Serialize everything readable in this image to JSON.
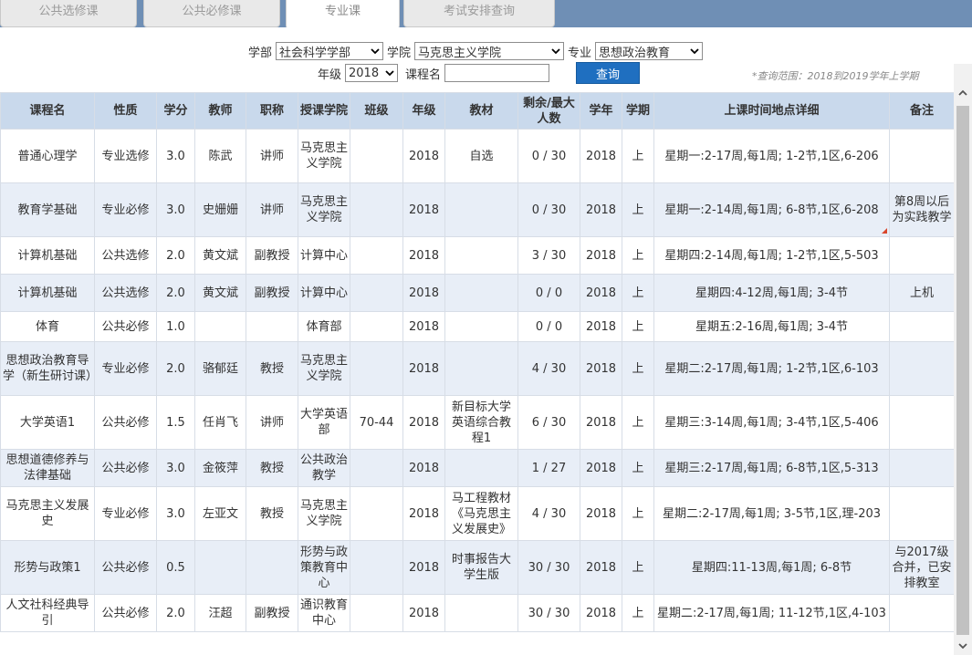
{
  "tabs": [
    {
      "label": "公共选修课",
      "active": false
    },
    {
      "label": "公共必修课",
      "active": false
    },
    {
      "label": "专业课",
      "active": true
    },
    {
      "label": "考试安排查询",
      "active": false
    }
  ],
  "filters": {
    "department_label": "学部",
    "department_value": "社会科学学部",
    "college_label": "学院",
    "college_value": "马克思主义学院",
    "major_label": "专业",
    "major_value": "思想政治教育",
    "grade_label": "年级",
    "grade_value": "2018",
    "course_name_label": "课程名",
    "course_name_value": "",
    "query_button": "查询",
    "query_range_note": "*查询范围：2018到2019学年上学期"
  },
  "table": {
    "headers": [
      "课程名",
      "性质",
      "学分",
      "教师",
      "职称",
      "授课学院",
      "班级",
      "年级",
      "教材",
      "剩余/最大人数",
      "学年",
      "学期",
      "上课时间地点详细",
      "备注"
    ],
    "rows": [
      {
        "course": "普通心理学",
        "type": "专业选修",
        "credit": "3.0",
        "teacher": "陈武",
        "title": "讲师",
        "college": "马克思主义学院",
        "class": "",
        "grade": "2018",
        "textbook": "自选",
        "capacity": "0 / 30",
        "year": "2018",
        "term": "上",
        "schedule": "星期一:2-17周,每1周; 1-2节,1区,6-206",
        "note": ""
      },
      {
        "course": "教育学基础",
        "type": "专业必修",
        "credit": "3.0",
        "teacher": "史姗姗",
        "title": "讲师",
        "college": "马克思主义学院",
        "class": "",
        "grade": "2018",
        "textbook": "",
        "capacity": "0 / 30",
        "year": "2018",
        "term": "上",
        "schedule": "星期一:2-14周,每1周; 6-8节,1区,6-208",
        "note": "第8周以后为实践教学"
      },
      {
        "course": "计算机基础",
        "type": "公共选修",
        "credit": "2.0",
        "teacher": "黄文斌",
        "title": "副教授",
        "college": "计算中心",
        "class": "",
        "grade": "2018",
        "textbook": "",
        "capacity": "3 / 30",
        "year": "2018",
        "term": "上",
        "schedule": "星期四:2-14周,每1周; 1-2节,1区,5-503",
        "note": ""
      },
      {
        "course": "计算机基础",
        "type": "公共选修",
        "credit": "2.0",
        "teacher": "黄文斌",
        "title": "副教授",
        "college": "计算中心",
        "class": "",
        "grade": "2018",
        "textbook": "",
        "capacity": "0 / 0",
        "year": "2018",
        "term": "上",
        "schedule": "星期四:4-12周,每1周; 3-4节",
        "note": "上机"
      },
      {
        "course": "体育",
        "type": "公共必修",
        "credit": "1.0",
        "teacher": "",
        "title": "",
        "college": "体育部",
        "class": "",
        "grade": "2018",
        "textbook": "",
        "capacity": "0 / 0",
        "year": "2018",
        "term": "上",
        "schedule": "星期五:2-16周,每1周; 3-4节",
        "note": ""
      },
      {
        "course": "思想政治教育导学（新生研讨课）",
        "type": "专业必修",
        "credit": "2.0",
        "teacher": "骆郁廷",
        "title": "教授",
        "college": "马克思主义学院",
        "class": "",
        "grade": "2018",
        "textbook": "",
        "capacity": "4 / 30",
        "year": "2018",
        "term": "上",
        "schedule": "星期二:2-17周,每1周; 1-2节,1区,6-103",
        "note": ""
      },
      {
        "course": "大学英语1",
        "type": "公共必修",
        "credit": "1.5",
        "teacher": "任肖飞",
        "title": "讲师",
        "college": "大学英语部",
        "class": "70-44",
        "grade": "2018",
        "textbook": "新目标大学英语综合教程1",
        "capacity": "6 / 30",
        "year": "2018",
        "term": "上",
        "schedule": "星期三:3-14周,每1周; 3-4节,1区,5-406",
        "note": ""
      },
      {
        "course": "思想道德修养与法律基础",
        "type": "公共必修",
        "credit": "3.0",
        "teacher": "金筱萍",
        "title": "教授",
        "college": "公共政治教学",
        "class": "",
        "grade": "2018",
        "textbook": "",
        "capacity": "1 / 27",
        "year": "2018",
        "term": "上",
        "schedule": "星期三:2-17周,每1周; 6-8节,1区,5-313",
        "note": ""
      },
      {
        "course": "马克思主义发展史",
        "type": "专业必修",
        "credit": "3.0",
        "teacher": "左亚文",
        "title": "教授",
        "college": "马克思主义学院",
        "class": "",
        "grade": "2018",
        "textbook": "马工程教材《马克思主义发展史》",
        "capacity": "4 / 30",
        "year": "2018",
        "term": "上",
        "schedule": "星期二:2-17周,每1周; 3-5节,1区,理-203",
        "note": ""
      },
      {
        "course": "形势与政策1",
        "type": "公共必修",
        "credit": "0.5",
        "teacher": "",
        "title": "",
        "college": "形势与政策教育中心",
        "class": "",
        "grade": "2018",
        "textbook": "时事报告大学生版",
        "capacity": "30 / 30",
        "year": "2018",
        "term": "上",
        "schedule": "星期四:11-13周,每1周; 6-8节",
        "note": "与2017级合并，已安排教室"
      },
      {
        "course": "人文社科经典导引",
        "type": "公共必修",
        "credit": "2.0",
        "teacher": "汪超",
        "title": "副教授",
        "college": "通识教育中心",
        "class": "",
        "grade": "2018",
        "textbook": "",
        "capacity": "30 / 30",
        "year": "2018",
        "term": "上",
        "schedule": "星期二:2-17周,每1周; 11-12节,1区,4-103",
        "note": ""
      }
    ]
  },
  "icons": {
    "select_arrow": "chevron-down-icon",
    "scroll_up": "chevron-up-icon",
    "scroll_down": "chevron-down-icon"
  },
  "colors": {
    "tabbar": "#6f8fb5",
    "header_bg": "#c9d9ec",
    "alt_row_bg": "#e8eef7",
    "button_bg": "#1f6fc0"
  }
}
